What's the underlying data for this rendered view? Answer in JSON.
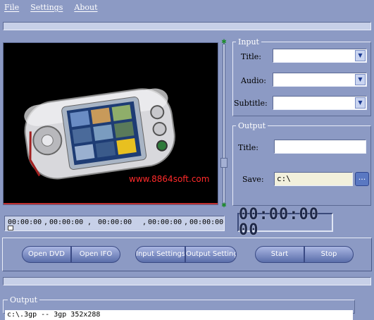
{
  "menu": [
    "File",
    "Settings",
    "About"
  ],
  "video": {
    "watermark": "www.8864soft.com"
  },
  "input_group": {
    "legend": "Input",
    "title_label": "Title:",
    "audio_label": "Audio:",
    "subtitle_label": "Subtitle:",
    "title_value": "",
    "audio_value": "",
    "subtitle_value": ""
  },
  "output_group": {
    "legend": "Output",
    "title_label": "Title:",
    "title_value": "",
    "save_label": "Save:",
    "save_value": "c:\\",
    "browse_label": "..."
  },
  "timeline": {
    "ticks": [
      "00:00:00",
      ",",
      "00:00:00",
      ",",
      "00:00:00",
      ",",
      "00:00:00",
      ",",
      "00:00:00"
    ],
    "position_fraction": 0.0
  },
  "clock": "00:00:00 00",
  "buttons": {
    "open_dvd": "Open DVD",
    "open_ifo": "Open IFO",
    "input_settings": "Input Settings",
    "output_settings": "Output Settings",
    "start": "Start",
    "stop": "Stop"
  },
  "output_log": {
    "legend": "Output",
    "text": "c:\\.3gp -- 3gp 352x288"
  },
  "colors": {
    "background": "#8c9ac4",
    "accent": "#5a6eaa"
  },
  "icons": [
    "dropdown-arrow-icon",
    "browse-icon",
    "slider-marker-icon"
  ]
}
